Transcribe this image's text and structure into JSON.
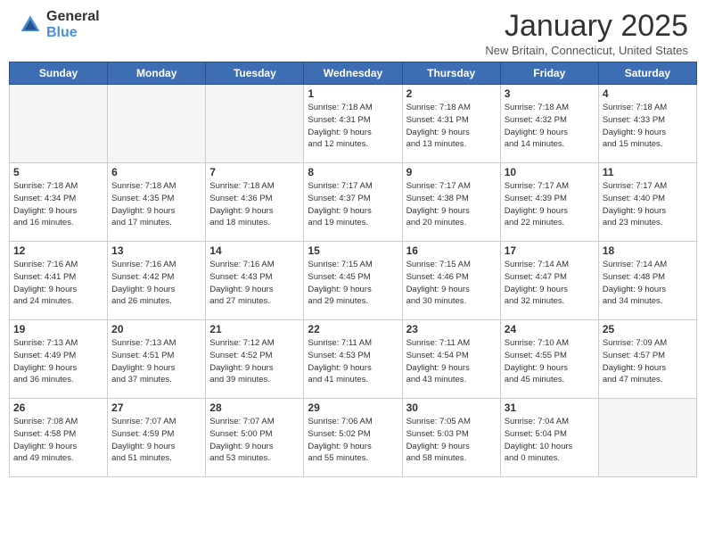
{
  "header": {
    "logo_general": "General",
    "logo_blue": "Blue",
    "month_year": "January 2025",
    "location": "New Britain, Connecticut, United States"
  },
  "days": [
    "Sunday",
    "Monday",
    "Tuesday",
    "Wednesday",
    "Thursday",
    "Friday",
    "Saturday"
  ],
  "weeks": [
    [
      {
        "num": "",
        "info": ""
      },
      {
        "num": "",
        "info": ""
      },
      {
        "num": "",
        "info": ""
      },
      {
        "num": "1",
        "info": "Sunrise: 7:18 AM\nSunset: 4:31 PM\nDaylight: 9 hours\nand 12 minutes."
      },
      {
        "num": "2",
        "info": "Sunrise: 7:18 AM\nSunset: 4:31 PM\nDaylight: 9 hours\nand 13 minutes."
      },
      {
        "num": "3",
        "info": "Sunrise: 7:18 AM\nSunset: 4:32 PM\nDaylight: 9 hours\nand 14 minutes."
      },
      {
        "num": "4",
        "info": "Sunrise: 7:18 AM\nSunset: 4:33 PM\nDaylight: 9 hours\nand 15 minutes."
      }
    ],
    [
      {
        "num": "5",
        "info": "Sunrise: 7:18 AM\nSunset: 4:34 PM\nDaylight: 9 hours\nand 16 minutes."
      },
      {
        "num": "6",
        "info": "Sunrise: 7:18 AM\nSunset: 4:35 PM\nDaylight: 9 hours\nand 17 minutes."
      },
      {
        "num": "7",
        "info": "Sunrise: 7:18 AM\nSunset: 4:36 PM\nDaylight: 9 hours\nand 18 minutes."
      },
      {
        "num": "8",
        "info": "Sunrise: 7:17 AM\nSunset: 4:37 PM\nDaylight: 9 hours\nand 19 minutes."
      },
      {
        "num": "9",
        "info": "Sunrise: 7:17 AM\nSunset: 4:38 PM\nDaylight: 9 hours\nand 20 minutes."
      },
      {
        "num": "10",
        "info": "Sunrise: 7:17 AM\nSunset: 4:39 PM\nDaylight: 9 hours\nand 22 minutes."
      },
      {
        "num": "11",
        "info": "Sunrise: 7:17 AM\nSunset: 4:40 PM\nDaylight: 9 hours\nand 23 minutes."
      }
    ],
    [
      {
        "num": "12",
        "info": "Sunrise: 7:16 AM\nSunset: 4:41 PM\nDaylight: 9 hours\nand 24 minutes."
      },
      {
        "num": "13",
        "info": "Sunrise: 7:16 AM\nSunset: 4:42 PM\nDaylight: 9 hours\nand 26 minutes."
      },
      {
        "num": "14",
        "info": "Sunrise: 7:16 AM\nSunset: 4:43 PM\nDaylight: 9 hours\nand 27 minutes."
      },
      {
        "num": "15",
        "info": "Sunrise: 7:15 AM\nSunset: 4:45 PM\nDaylight: 9 hours\nand 29 minutes."
      },
      {
        "num": "16",
        "info": "Sunrise: 7:15 AM\nSunset: 4:46 PM\nDaylight: 9 hours\nand 30 minutes."
      },
      {
        "num": "17",
        "info": "Sunrise: 7:14 AM\nSunset: 4:47 PM\nDaylight: 9 hours\nand 32 minutes."
      },
      {
        "num": "18",
        "info": "Sunrise: 7:14 AM\nSunset: 4:48 PM\nDaylight: 9 hours\nand 34 minutes."
      }
    ],
    [
      {
        "num": "19",
        "info": "Sunrise: 7:13 AM\nSunset: 4:49 PM\nDaylight: 9 hours\nand 36 minutes."
      },
      {
        "num": "20",
        "info": "Sunrise: 7:13 AM\nSunset: 4:51 PM\nDaylight: 9 hours\nand 37 minutes."
      },
      {
        "num": "21",
        "info": "Sunrise: 7:12 AM\nSunset: 4:52 PM\nDaylight: 9 hours\nand 39 minutes."
      },
      {
        "num": "22",
        "info": "Sunrise: 7:11 AM\nSunset: 4:53 PM\nDaylight: 9 hours\nand 41 minutes."
      },
      {
        "num": "23",
        "info": "Sunrise: 7:11 AM\nSunset: 4:54 PM\nDaylight: 9 hours\nand 43 minutes."
      },
      {
        "num": "24",
        "info": "Sunrise: 7:10 AM\nSunset: 4:55 PM\nDaylight: 9 hours\nand 45 minutes."
      },
      {
        "num": "25",
        "info": "Sunrise: 7:09 AM\nSunset: 4:57 PM\nDaylight: 9 hours\nand 47 minutes."
      }
    ],
    [
      {
        "num": "26",
        "info": "Sunrise: 7:08 AM\nSunset: 4:58 PM\nDaylight: 9 hours\nand 49 minutes."
      },
      {
        "num": "27",
        "info": "Sunrise: 7:07 AM\nSunset: 4:59 PM\nDaylight: 9 hours\nand 51 minutes."
      },
      {
        "num": "28",
        "info": "Sunrise: 7:07 AM\nSunset: 5:00 PM\nDaylight: 9 hours\nand 53 minutes."
      },
      {
        "num": "29",
        "info": "Sunrise: 7:06 AM\nSunset: 5:02 PM\nDaylight: 9 hours\nand 55 minutes."
      },
      {
        "num": "30",
        "info": "Sunrise: 7:05 AM\nSunset: 5:03 PM\nDaylight: 9 hours\nand 58 minutes."
      },
      {
        "num": "31",
        "info": "Sunrise: 7:04 AM\nSunset: 5:04 PM\nDaylight: 10 hours\nand 0 minutes."
      },
      {
        "num": "",
        "info": ""
      }
    ]
  ]
}
